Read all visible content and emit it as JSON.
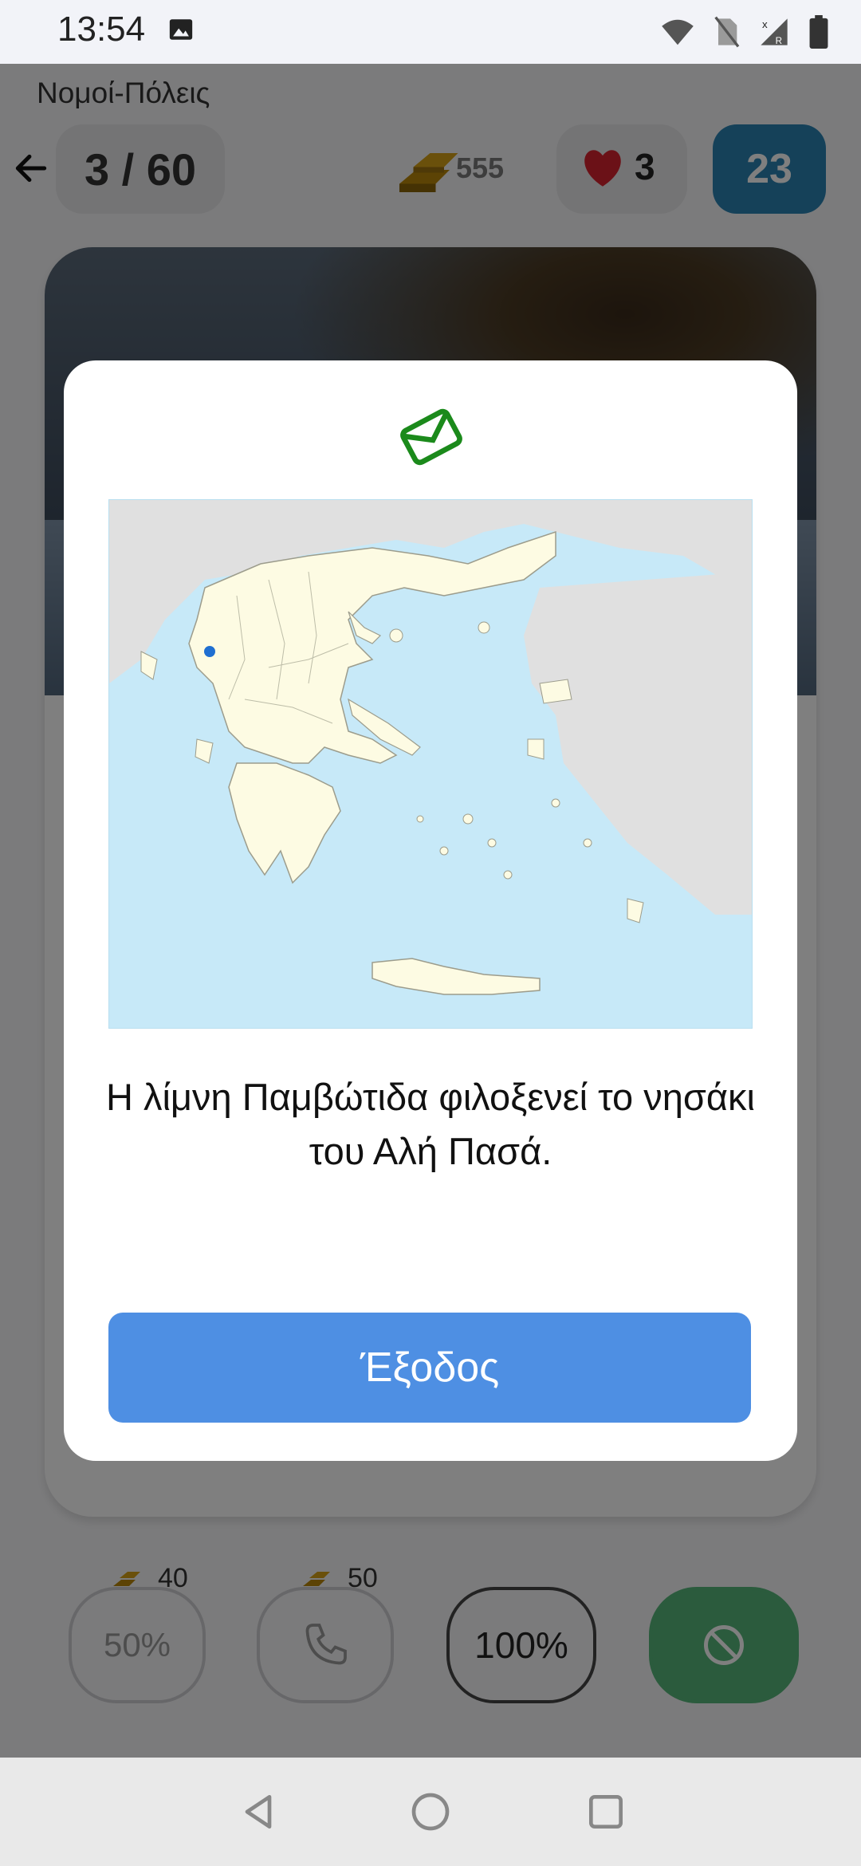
{
  "status_bar": {
    "time": "13:54",
    "icons": [
      "image-icon",
      "wifi-icon",
      "no-sim-icon",
      "signal-roaming-icon",
      "battery-icon"
    ]
  },
  "app": {
    "title": "Νομοί-Πόλεις",
    "counter": "3 / 60",
    "gold": "555",
    "lives": "3",
    "timer": "23"
  },
  "lifelines": {
    "fifty": {
      "label": "50%",
      "cost": "40"
    },
    "phone": {
      "cost": "50"
    },
    "hundred": {
      "label": "100%"
    }
  },
  "modal": {
    "text": "Η λίμνη Παμβώτιδα φιλοξενεί το νησάκι του Αλή Πασά.",
    "exit_label": "Έξοδος"
  },
  "colors": {
    "accent": "#4e8fe3",
    "timer": "#2b83b3",
    "envelope": "#1b8a1b",
    "marker": "#1f6fd1"
  }
}
